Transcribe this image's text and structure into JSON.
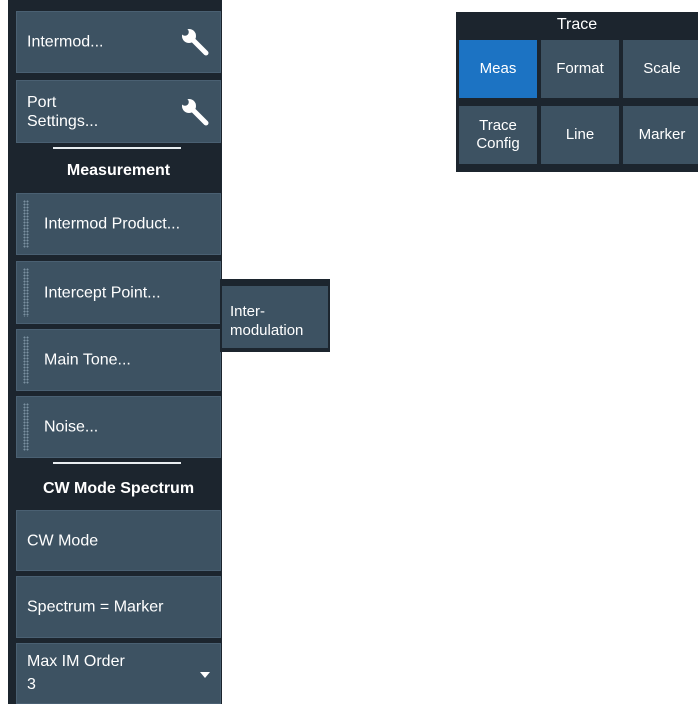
{
  "left_panel": {
    "intermod_button": "Intermod...",
    "port_settings_button": "Port\nSettings...",
    "measurement_heading": "Measurement",
    "intermod_product_button": "Intermod Product...",
    "intercept_point_button": "Intercept Point...",
    "main_tone_button": "Main Tone...",
    "noise_button": "Noise...",
    "cw_heading": "CW Mode Spectrum",
    "cw_mode_button": "CW Mode",
    "spectrum_marker_button": "Spectrum = Marker",
    "max_im_order_label": "Max IM Order",
    "max_im_order_value": "3"
  },
  "side_tab": {
    "label": "Inter-\nmodulation"
  },
  "trace_panel": {
    "title": "Trace",
    "buttons": [
      "Meas",
      "Format",
      "Scale",
      "Trace\nConfig",
      "Line",
      "Marker"
    ],
    "active": "Meas"
  },
  "colors": {
    "panel_bg": "#1c252e",
    "button_bg": "#3d5262",
    "active_bg": "#1c73c3"
  },
  "icons": [
    "wrench-icon",
    "drag-grip-icon",
    "dropdown-caret-icon"
  ]
}
